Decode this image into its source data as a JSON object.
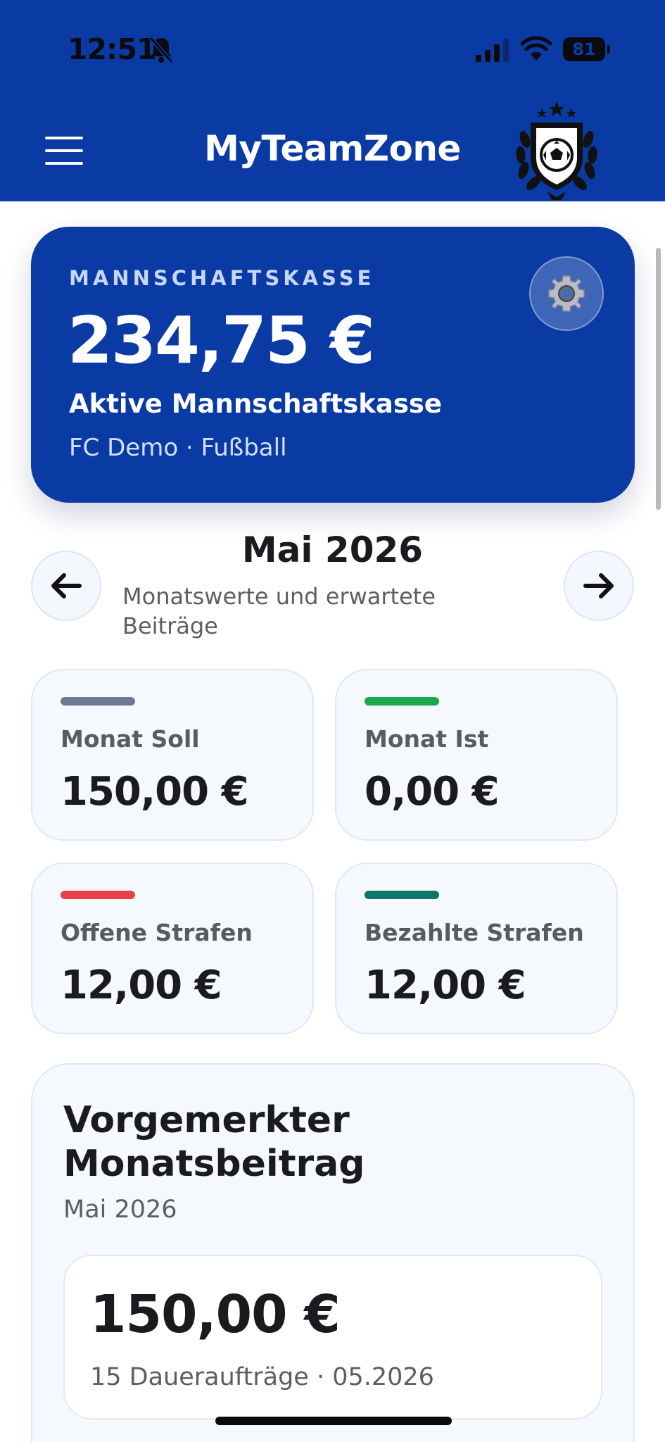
{
  "status_bar": {
    "time": "12:51",
    "battery": "81",
    "icons": [
      "bell-slash-icon",
      "signal-icon",
      "wifi-icon",
      "battery-icon"
    ]
  },
  "header": {
    "title": "MyTeamZone",
    "menu_icon": "hamburger-icon",
    "logo": "club-crest-logo"
  },
  "colors": {
    "brand": "#0a3aa4",
    "soll": "#6b7a91",
    "ist": "#1aa84a",
    "offene": "#e54248",
    "bezahlte": "#0d7668"
  },
  "hero": {
    "label": "MANNSCHAFTSKASSE",
    "amount": "234,75 €",
    "title": "Aktive Mannschaftskasse",
    "subtitle": "FC Demo · Fußball",
    "settings_icon": "gear-icon"
  },
  "month_nav": {
    "title": "Mai 2026",
    "subtitle": "Monatswerte und erwartete Beiträge",
    "prev_icon": "arrow-left-icon",
    "next_icon": "arrow-right-icon"
  },
  "stats": [
    {
      "label": "Monat Soll",
      "value": "150,00 €"
    },
    {
      "label": "Monat Ist",
      "value": "0,00 €"
    },
    {
      "label": "Offene Strafen",
      "value": "12,00 €"
    },
    {
      "label": "Bezahlte Strafen",
      "value": "12,00 €"
    }
  ],
  "pending_fee": {
    "title": "Vorgemerkter Monatsbeitrag",
    "month": "Mai 2026",
    "amount": "150,00 €",
    "detail": "15 Daueraufträge · 05.2026"
  }
}
